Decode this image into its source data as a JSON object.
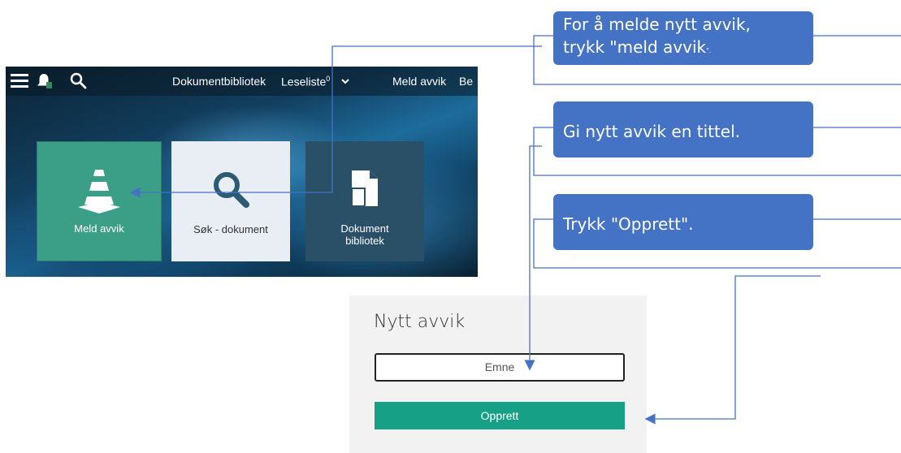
{
  "app": {
    "topbar": {
      "library": "Dokumentbibliotek",
      "reading_list": "Leseliste",
      "reading_list_count": "0",
      "report": "Meld avvik",
      "truncated": "Be"
    },
    "tiles": [
      {
        "label": "Meld avvik",
        "icon": "traffic-cone-icon"
      },
      {
        "label": "Søk - dokument",
        "icon": "search-icon"
      },
      {
        "label_line1": "Dokument",
        "label_line2": "bibliotek",
        "icon": "document-icon"
      }
    ]
  },
  "callouts": {
    "one_line1": "For å melde nytt avvik,",
    "one_line2": "trykk \"meld avvik",
    "one_tail": "\".",
    "two": "Gi nytt avvik en tittel.",
    "three": "Trykk \"Opprett\"."
  },
  "dialog": {
    "title": "Nytt avvik",
    "input_placeholder": "Emne",
    "button": "Opprett"
  },
  "colors": {
    "callout": "#4472c4",
    "accent": "#16a085",
    "tile_meld": "#3b9e86"
  }
}
